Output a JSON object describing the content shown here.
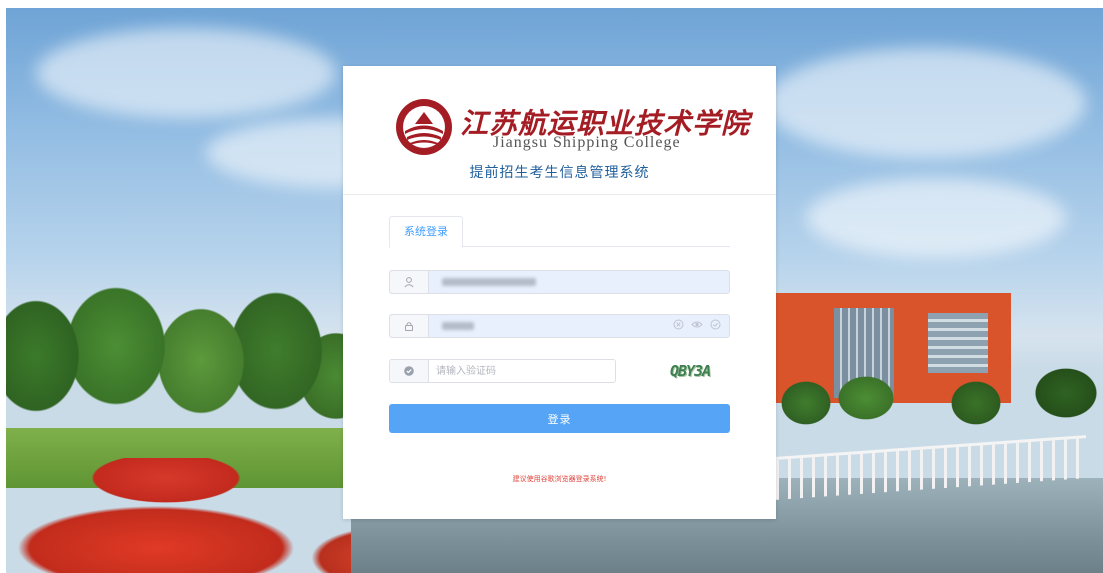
{
  "college": {
    "name_cn": "江苏航运职业技术学院",
    "name_en": "Jiangsu Shipping College",
    "emblem_text": "江苏航运职业技术学院"
  },
  "system": {
    "title": "提前招生考生信息管理系统"
  },
  "tabs": [
    {
      "label": "系统登录",
      "active": true
    }
  ],
  "form": {
    "username": {
      "value_obscured": true
    },
    "password": {
      "value_obscured": true,
      "actions": [
        "clear-icon",
        "eye-icon",
        "check-circle-icon"
      ]
    },
    "captcha": {
      "placeholder": "请输入验证码",
      "value": "",
      "image_text": "QBY3A"
    },
    "login_label": "登录"
  },
  "tip": "建议使用谷歌浏览器登录系统!",
  "colors": {
    "brand_red": "#a51d24",
    "title_blue": "#1f5f9c",
    "primary": "#55a4f5",
    "tab_active": "#409eff",
    "tip_red": "#e0433a"
  }
}
